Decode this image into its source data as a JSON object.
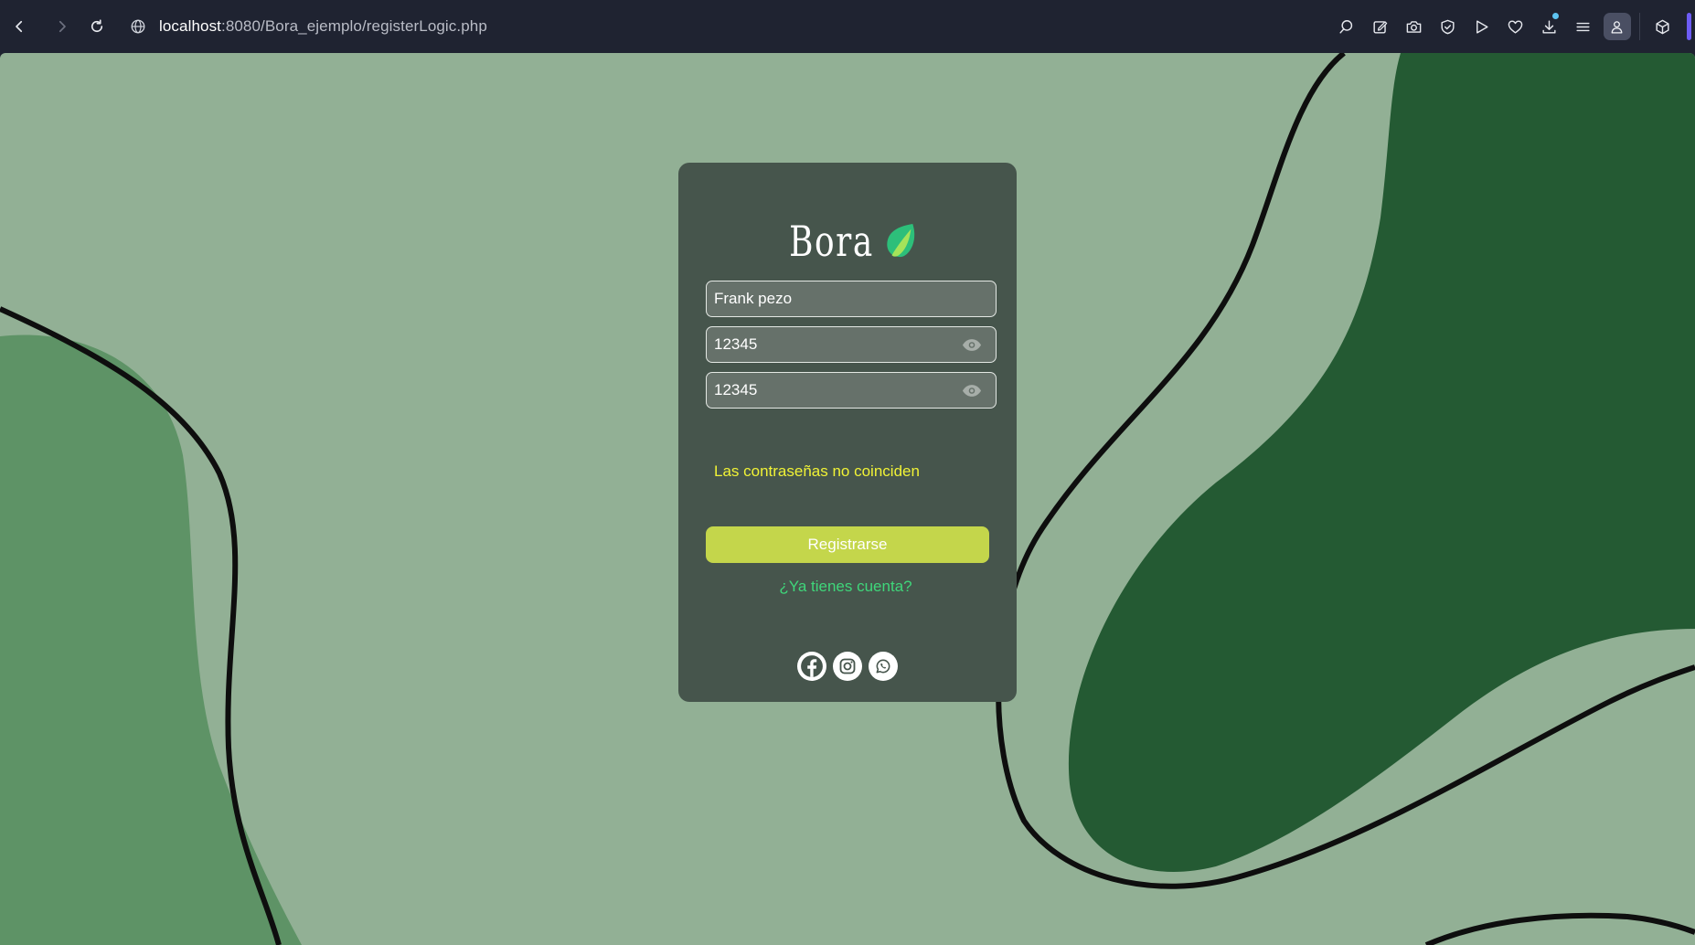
{
  "browser": {
    "url_host": "localhost",
    "url_rest": ":8080/Bora_ejemplo/registerLogic.php",
    "toolbar_icons": [
      "search-page-icon",
      "edit-icon",
      "camera-icon",
      "shield-icon",
      "play-icon",
      "heart-icon",
      "download-icon",
      "menu-icon",
      "profile-icon",
      "extensions-icon"
    ]
  },
  "form": {
    "logo_text": "Bora",
    "username_value": "Frank pezo",
    "password_value": "12345",
    "confirm_value": "12345",
    "error_message": "Las contraseñas no coinciden",
    "submit_label": "Registrarse",
    "login_link": "¿Ya tienes cuenta?"
  },
  "socials": [
    "facebook-icon",
    "instagram-icon",
    "whatsapp-icon"
  ],
  "colors": {
    "page_bg": "#92b095",
    "dark_green": "#245a33",
    "mid_green": "#5e9366",
    "card_bg": "#46554c",
    "button_bg": "#c4d64b",
    "error_text": "#f0f236",
    "link_text": "#3fd67a"
  }
}
